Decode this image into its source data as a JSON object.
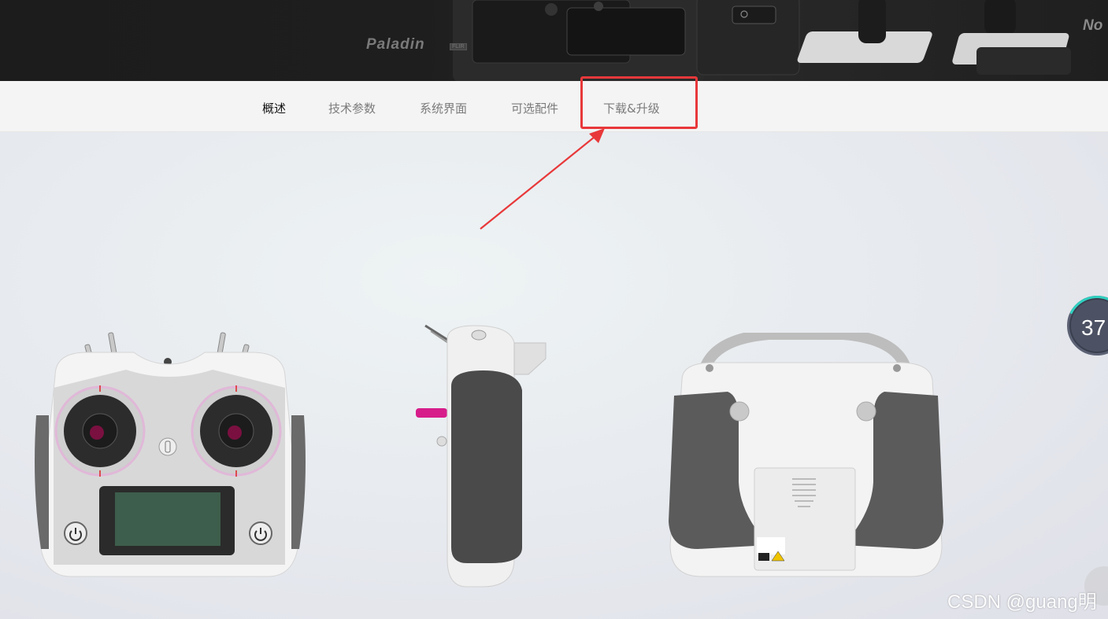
{
  "banner": {
    "brand": "Paladin",
    "brand_sub": "FLIR",
    "brand_right": "No"
  },
  "nav": {
    "items": [
      {
        "label": "概述",
        "active": true
      },
      {
        "label": "技术参数",
        "active": false
      },
      {
        "label": "系统界面",
        "active": false
      },
      {
        "label": "可选配件",
        "active": false
      },
      {
        "label": "下载&升级",
        "active": false
      }
    ]
  },
  "annotation": {
    "box_color": "#e8383a",
    "arrow_color": "#e8383a",
    "target": "下载&升级"
  },
  "products": [
    {
      "name": "transmitter-front",
      "icon": "remote-controller-front"
    },
    {
      "name": "transmitter-side",
      "icon": "remote-controller-side"
    },
    {
      "name": "transmitter-back",
      "icon": "remote-controller-back"
    }
  ],
  "floating": {
    "counter_value": "37",
    "accent": "#2fd0c0"
  },
  "watermark": "CSDN @guang明"
}
